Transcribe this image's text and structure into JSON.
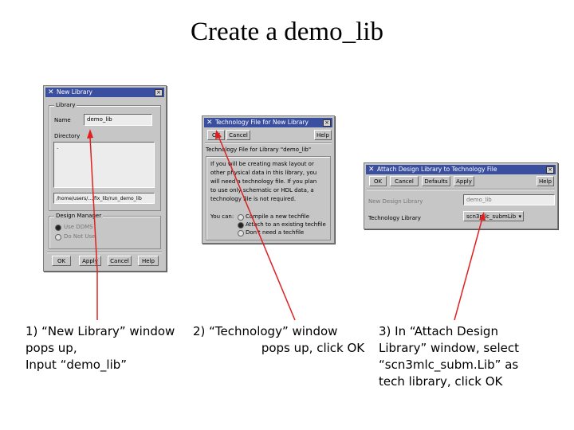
{
  "slide_title": "Create a demo_lib",
  "new_library": {
    "title": "New Library",
    "library_group": "Library",
    "name_label": "Name",
    "name_value": "demo_lib",
    "directory_label": "Directory",
    "directory_item": ".",
    "path_value": "/home/users/.../fix_lib/run_demo_lib",
    "design_manager_group": "Design Manager",
    "dm_options": [
      "Use DDMS",
      "Do Not Use"
    ],
    "buttons": [
      "OK",
      "Apply",
      "Cancel",
      "Help"
    ]
  },
  "technology_file": {
    "title": "Technology File for New Library",
    "buttons": [
      "OK",
      "Cancel",
      "Help"
    ],
    "heading": "Technology File for Library \"demo_lib\"",
    "body_lines": [
      "If you will be creating mask layout or",
      "other physical data in this library, you",
      "will need a technology file. If you plan",
      "to use only schematic or HDL data, a",
      "technology file is not required."
    ],
    "you_can_label": "You can:",
    "options": [
      "Compile a new techfile",
      "Attach to an existing techfile",
      "Don't need a techfile"
    ]
  },
  "attach_design": {
    "title": "Attach Design Library to Technology File",
    "buttons": [
      "OK",
      "Cancel",
      "Defaults",
      "Apply",
      "Help"
    ],
    "design_library_label": "New Design Library",
    "design_library_value": "demo_lib",
    "tech_library_label": "Technology Library",
    "tech_library_value": "scn3mlc_submLib"
  },
  "captions": {
    "step1": "1) “New Library” window\npops up,\nInput “demo_lib”",
    "step2": "2) “Technology” window\n                  pops up, click OK",
    "step3": "3) In “Attach Design\nLibrary” window, select\n“scn3mlc_subm.Lib” as\ntech library, click OK"
  },
  "colors": {
    "window_bg": "#c6c6c6",
    "title_bar": "#3a4fa0",
    "arrow": "#e02020"
  }
}
